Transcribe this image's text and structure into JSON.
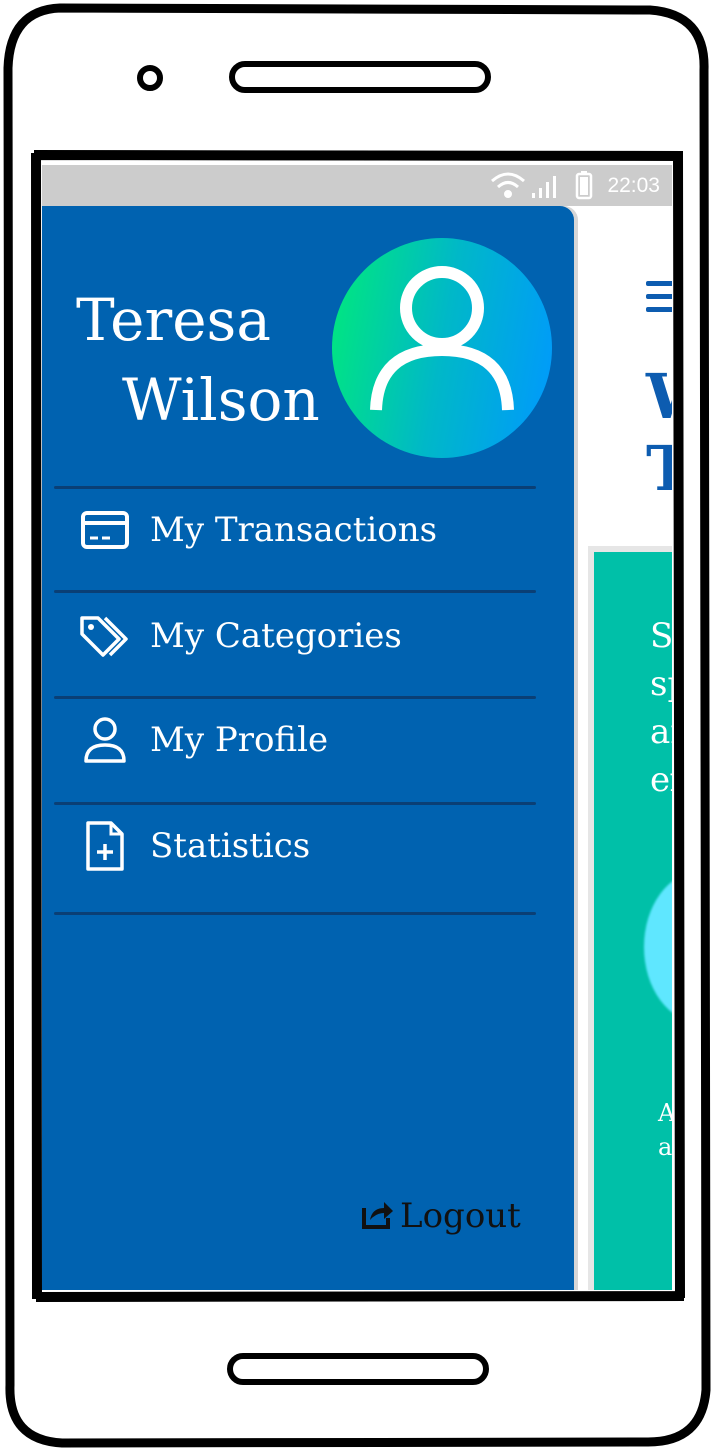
{
  "status_bar": {
    "time": "22:03",
    "icons": [
      "wifi-icon",
      "signal-icon",
      "battery-icon"
    ]
  },
  "drawer": {
    "user_name_line1": "Teresa",
    "user_name_line2": "Wilson",
    "avatar_icon": "user-icon",
    "menu": [
      {
        "label": "My Transactions",
        "icon": "credit-card-icon"
      },
      {
        "label": "My Categories",
        "icon": "tags-icon"
      },
      {
        "label": "My Profile",
        "icon": "user-icon"
      },
      {
        "label": "Statistics",
        "icon": "file-plus-icon"
      }
    ],
    "logout_label": "Logout",
    "logout_icon": "share-out-icon"
  },
  "background": {
    "title": "W\nT",
    "card_text": "Sa\nsp\nar\nex",
    "card_footer": "A\na"
  },
  "colors": {
    "drawer_bg": "#0062b0",
    "card_bg": "#00c0a8",
    "accent": "#0d5cb0"
  }
}
